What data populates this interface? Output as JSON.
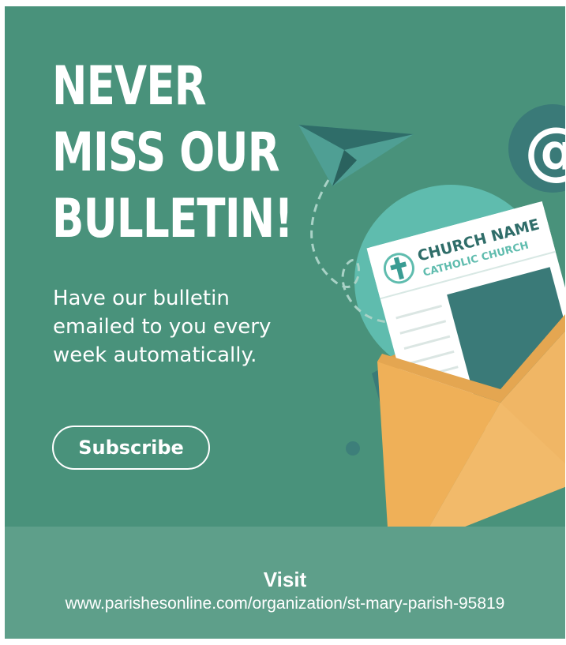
{
  "promo": {
    "headline_lines": [
      "NEVER",
      "MISS OUR",
      "BULLETIN!"
    ],
    "description_lines": [
      "Have our bulletin",
      "emailed to you every",
      "week automatically."
    ],
    "button_label": "Subscribe"
  },
  "illustration": {
    "church_name": "CHURCH NAME",
    "church_type": "CATHOLIC CHURCH",
    "at_symbol": "@",
    "icons": [
      "paper-plane-icon",
      "at-sign-icon",
      "cross-icon",
      "envelope-icon",
      "newsletter-icon"
    ]
  },
  "footer": {
    "visit_label": "Visit",
    "url": "www.parishesonline.com/organization/st-mary-parish-95819"
  },
  "colors": {
    "background": "#49927b",
    "footer_background": "#5e9f8a",
    "text": "#ffffff",
    "envelope": "#efb058",
    "envelope_dark": "#dda04a",
    "accent_teal": "#5fbcae",
    "dark_teal": "#3a7a78"
  }
}
